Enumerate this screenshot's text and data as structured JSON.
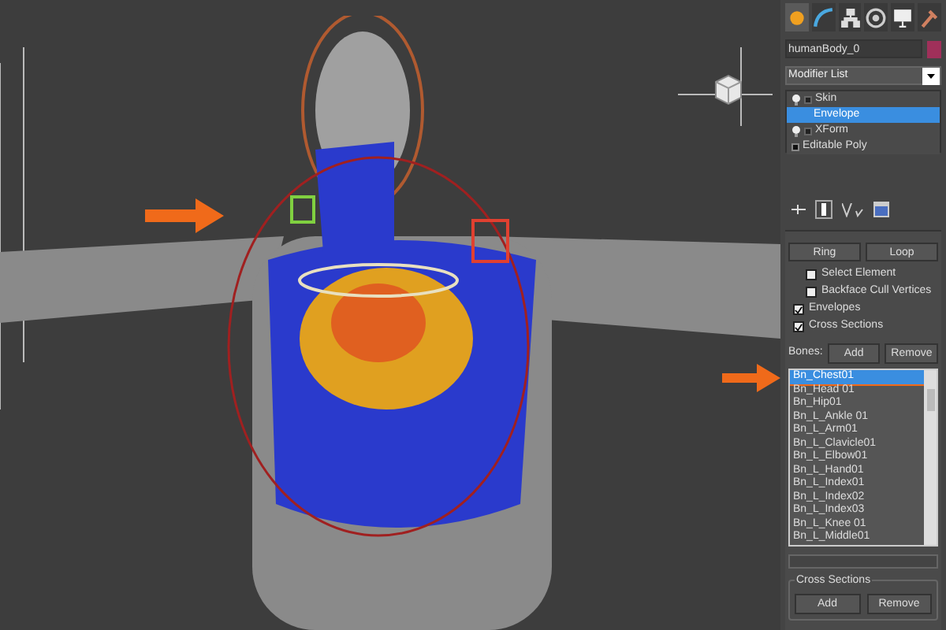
{
  "panel_tabs": [
    {
      "selected": true
    },
    {
      "selected": false
    },
    {
      "selected": false
    },
    {
      "selected": false
    },
    {
      "selected": false
    },
    {
      "selected": false
    }
  ],
  "object_name": {
    "value": "humanBody_0",
    "color": "#a0305a"
  },
  "modifier_list": {
    "value": "Modifier List"
  },
  "stack": [
    {
      "label": "Skin",
      "selected": false,
      "kind": "modifier"
    },
    {
      "label": "Envelope",
      "selected": true,
      "kind": "sub"
    },
    {
      "label": "XForm",
      "selected": false,
      "kind": "modifier"
    },
    {
      "label": "Editable Poly",
      "selected": false,
      "kind": "base"
    }
  ],
  "rollout": {
    "buttons": [
      "Ring",
      "Loop"
    ],
    "options": [
      {
        "label": "Select Element",
        "checked": false
      },
      {
        "label": "Backface Cull Vertices",
        "checked": false
      },
      {
        "label": "Envelopes",
        "checked": true
      },
      {
        "label": "Cross Sections",
        "checked": true
      }
    ],
    "bones_label": "Bones:",
    "bones_buttons": [
      "Add",
      "Remove"
    ],
    "bones": [
      {
        "label": "Bn_Chest01",
        "selected": true
      },
      {
        "label": "Bn_Head 01",
        "selected": false
      },
      {
        "label": "Bn_Hip01",
        "selected": false
      },
      {
        "label": "Bn_L_Ankle 01",
        "selected": false
      },
      {
        "label": "Bn_L_Arm01",
        "selected": false
      },
      {
        "label": "Bn_L_Clavicle01",
        "selected": false
      },
      {
        "label": "Bn_L_Elbow01",
        "selected": false
      },
      {
        "label": "Bn_L_Hand01",
        "selected": false
      },
      {
        "label": "Bn_L_Index01",
        "selected": false
      },
      {
        "label": "Bn_L_Index02",
        "selected": false
      },
      {
        "label": "Bn_L_Index03",
        "selected": false
      },
      {
        "label": "Bn_L_Knee 01",
        "selected": false
      },
      {
        "label": "Bn_L_Middle01",
        "selected": false
      }
    ],
    "cross_sections": {
      "title": "Cross Sections",
      "buttons": [
        "Add",
        "Remove"
      ]
    }
  }
}
